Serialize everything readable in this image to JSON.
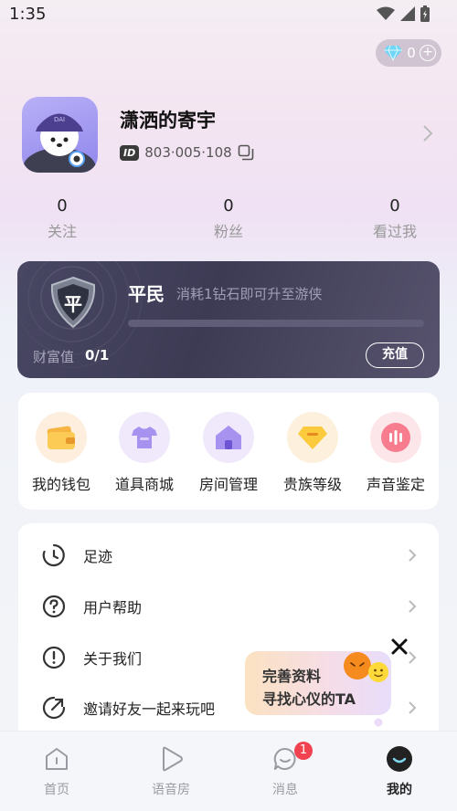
{
  "status_bar": {
    "time": "1:35"
  },
  "wallet": {
    "diamond_count": "0"
  },
  "profile": {
    "username": "潇洒的寄宇",
    "id_badge": "ID",
    "id_number": "803·005·108"
  },
  "stats": [
    {
      "value": "0",
      "label": "关注"
    },
    {
      "value": "0",
      "label": "粉丝"
    },
    {
      "value": "0",
      "label": "看过我"
    }
  ],
  "level_card": {
    "badge_char": "平",
    "title": "平民",
    "description": "消耗1钻石即可升至游侠",
    "progress": 0,
    "wealth_label": "财富值",
    "wealth_value": "0/1",
    "recharge_label": "充值"
  },
  "features": [
    {
      "label": "我的钱包",
      "icon": "wallet-icon",
      "bg": "#fdeedd"
    },
    {
      "label": "道具商城",
      "icon": "shop-icon",
      "bg": "#efe9fb"
    },
    {
      "label": "房间管理",
      "icon": "house-icon",
      "bg": "#efe9fb"
    },
    {
      "label": "贵族等级",
      "icon": "gem-icon",
      "bg": "#fdf1de"
    },
    {
      "label": "声音鉴定",
      "icon": "voice-icon",
      "bg": "#fde6ea"
    }
  ],
  "menu": [
    {
      "label": "足迹",
      "icon": "footprint-icon"
    },
    {
      "label": "用户帮助",
      "icon": "question-icon"
    },
    {
      "label": "关于我们",
      "icon": "info-icon"
    },
    {
      "label": "邀请好友一起来玩吧",
      "icon": "share-icon"
    }
  ],
  "promo": {
    "line1": "完善资料",
    "line2": "寻找心仪的TA"
  },
  "bottom_nav": [
    {
      "label": "首页",
      "icon": "home-icon",
      "active": false
    },
    {
      "label": "语音房",
      "icon": "play-icon",
      "active": false
    },
    {
      "label": "消息",
      "icon": "chat-icon",
      "active": false,
      "badge": "1"
    },
    {
      "label": "我的",
      "icon": "profile-icon",
      "active": true
    }
  ],
  "colors": {
    "accent_purple": "#9d93f2",
    "card_dark": "#3d3b54",
    "badge_red": "#f0434f"
  }
}
